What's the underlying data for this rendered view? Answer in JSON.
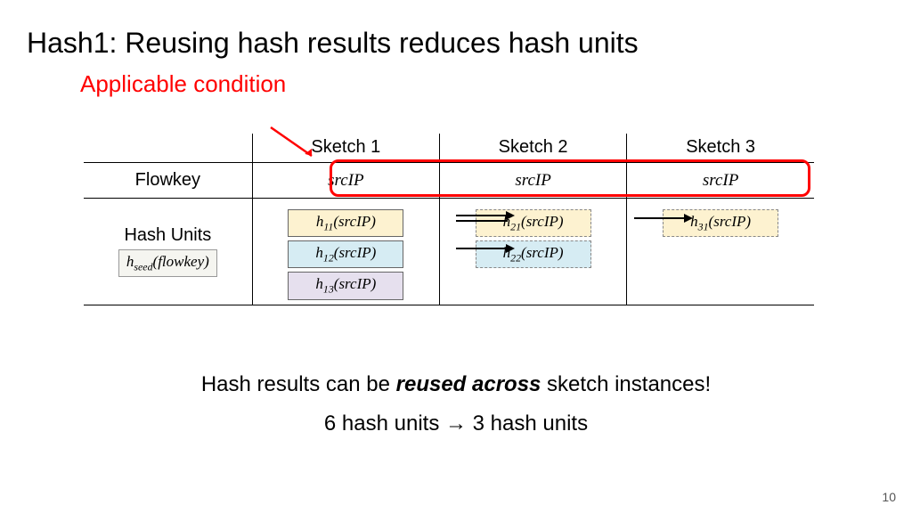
{
  "title": "Hash1: Reusing hash results reduces hash units",
  "condition": "Applicable condition",
  "table": {
    "cols": [
      "Sketch 1",
      "Sketch 2",
      "Sketch 3"
    ],
    "rowlabel_flowkey": "Flowkey",
    "flowkey": [
      "srcIP",
      "srcIP",
      "srcIP"
    ],
    "rowlabel_hash": "Hash Units",
    "hash_formula": "h_seed(flowkey)",
    "hash": {
      "c1": [
        "h₁₁(srcIP)",
        "h₁₂(srcIP)",
        "h₁₃(srcIP)"
      ],
      "c2": [
        "h₂₁(srcIP)",
        "h₂₂(srcIP)"
      ],
      "c3": [
        "h₃₁(srcIP)"
      ]
    }
  },
  "result_line1_a": "Hash results can be ",
  "result_line1_b": "reused across",
  "result_line1_c": " sketch instances!",
  "result_line2": "6 hash units → 3 hash units",
  "page": "10"
}
